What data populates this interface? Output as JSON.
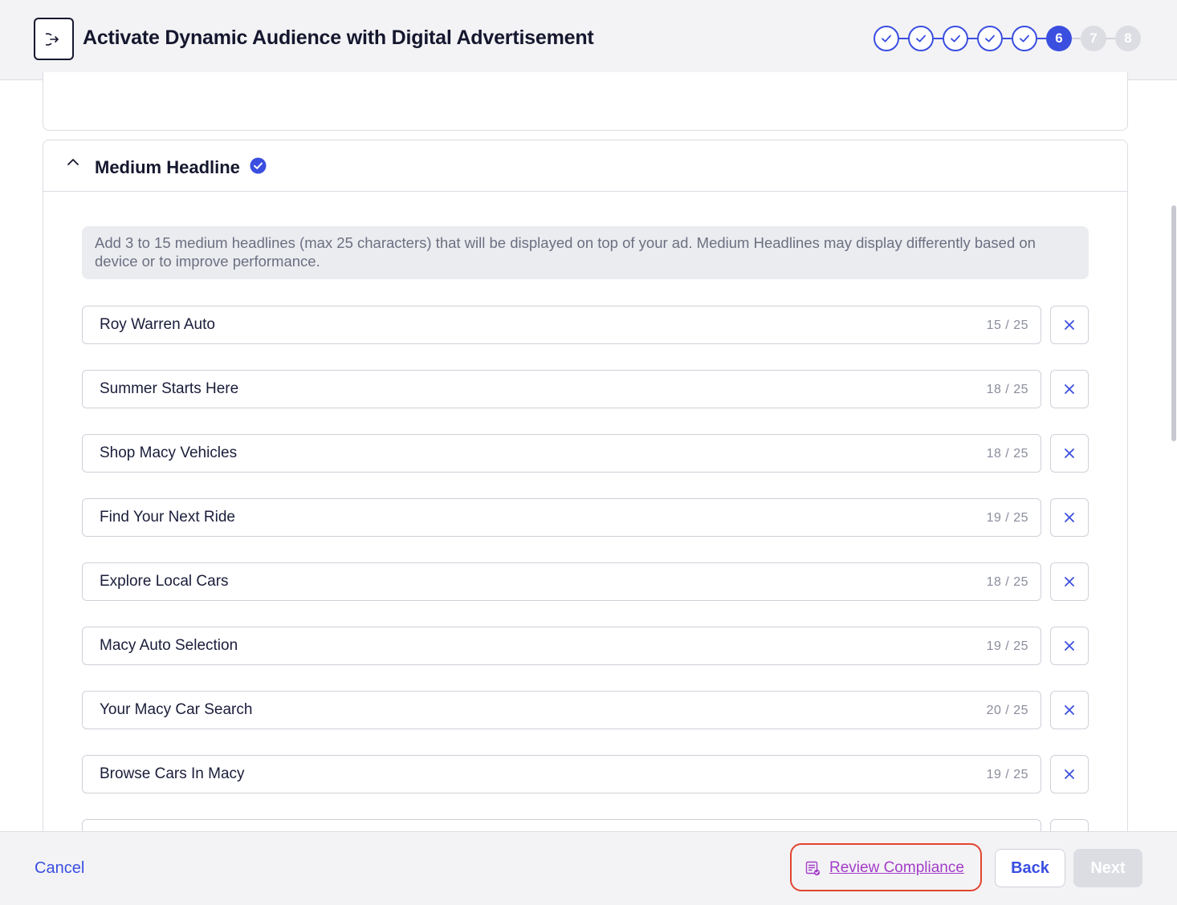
{
  "header": {
    "title": "Activate Dynamic Audience with Digital Advertisement",
    "exit_icon": "exit-arrow-icon",
    "steps": [
      {
        "label": "",
        "state": "done"
      },
      {
        "label": "",
        "state": "done"
      },
      {
        "label": "",
        "state": "done"
      },
      {
        "label": "",
        "state": "done"
      },
      {
        "label": "",
        "state": "done"
      },
      {
        "label": "6",
        "state": "current"
      },
      {
        "label": "7",
        "state": "todo"
      },
      {
        "label": "8",
        "state": "todo"
      }
    ]
  },
  "section": {
    "title": "Medium Headline",
    "info": "Add 3 to 15 medium headlines (max 25 characters) that will be displayed on top of your ad. Medium Headlines may display differently based on device or to improve performance.",
    "headlines": [
      {
        "text": "Roy Warren Auto",
        "count": "15 / 25"
      },
      {
        "text": "Summer Starts Here",
        "count": "18 / 25"
      },
      {
        "text": "Shop Macy Vehicles",
        "count": "18 / 25"
      },
      {
        "text": "Find Your Next Ride",
        "count": "19 / 25"
      },
      {
        "text": "Explore Local Cars",
        "count": "18 / 25"
      },
      {
        "text": "Macy Auto Selection",
        "count": "19 / 25"
      },
      {
        "text": "Your Macy Car Search",
        "count": "20 / 25"
      },
      {
        "text": "Browse Cars In Macy",
        "count": "19 / 25"
      },
      {
        "text": "",
        "count": ""
      }
    ]
  },
  "footer": {
    "cancel": "Cancel",
    "review_compliance": "Review Compliance",
    "back": "Back",
    "next": "Next"
  },
  "colors": {
    "accent": "#3a4ee0",
    "compliance": "#a43cc8",
    "highlight_ring": "#e2442f"
  }
}
